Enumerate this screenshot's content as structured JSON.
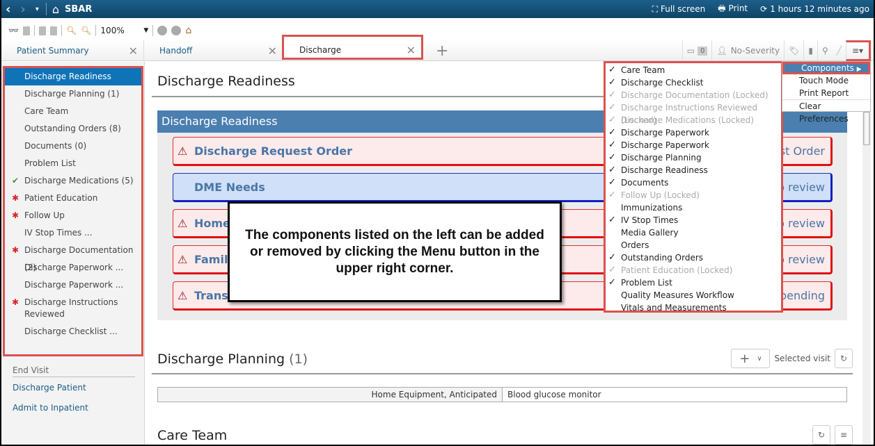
{
  "titlebar": {
    "back_icon": "‹",
    "forward_icon": "›",
    "dropdown_icon": "▾",
    "home_icon": "⌂",
    "title": "SBAR",
    "fullscreen_label": "Full screen",
    "print_label": "Print",
    "refresh_label": "1 hours 12 minutes ago"
  },
  "toolbar": {
    "zoom_value": "100%"
  },
  "tabs": {
    "patient_summary": "Patient Summary",
    "handoff": "Handoff",
    "discharge": "Discharge",
    "add": "+",
    "inbox_count": "0",
    "severity": "No-Severity"
  },
  "sidebar": {
    "items": [
      {
        "label": "Discharge Readiness",
        "mark": ""
      },
      {
        "label": "Discharge Planning  (1)",
        "mark": ""
      },
      {
        "label": "Care Team",
        "mark": ""
      },
      {
        "label": "Outstanding Orders  (8)",
        "mark": ""
      },
      {
        "label": "Documents  (0)",
        "mark": ""
      },
      {
        "label": "Problem List",
        "mark": ""
      },
      {
        "label": "Discharge Medications  (5)",
        "mark": "check"
      },
      {
        "label": "Patient Education",
        "mark": "star"
      },
      {
        "label": "Follow Up",
        "mark": "star"
      },
      {
        "label": "IV Stop Times ...",
        "mark": ""
      },
      {
        "label": "Discharge Documentation  (2)",
        "mark": "star"
      },
      {
        "label": "Discharge Paperwork ...",
        "mark": ""
      },
      {
        "label": "Discharge Paperwork ...",
        "mark": ""
      },
      {
        "label": "Discharge Instructions Reviewed",
        "mark": "star"
      },
      {
        "label": "Discharge Checklist ...",
        "mark": ""
      }
    ],
    "end_visit": "End Visit",
    "discharge_patient": "Discharge Patient",
    "admit_inpatient": "Admit to Inpatient"
  },
  "main": {
    "readiness_title": "Discharge Readiness",
    "readiness_header": "Discharge Readiness",
    "cards": [
      {
        "label": "Discharge Request Order",
        "right": "est Order",
        "style": "red",
        "warn": true
      },
      {
        "label": "DME Needs",
        "right": "to review",
        "style": "blue",
        "warn": false
      },
      {
        "label": "Home",
        "right": "to review",
        "style": "red",
        "warn": true
      },
      {
        "label": "Family",
        "right": "to review",
        "style": "red",
        "warn": true
      },
      {
        "label": "Transp",
        "right": "t pending",
        "style": "red",
        "warn": true
      }
    ],
    "planning_title": "Discharge Planning",
    "planning_count": "(1)",
    "selected_visit": "Selected visit",
    "planning_row": {
      "category": "Home Equipment, Anticipated",
      "value": "Blood glucose monitor"
    },
    "care_team_title": "Care Team"
  },
  "callout": {
    "text": "The components listed on the left can be added or removed by clicking the Menu button in the upper right corner."
  },
  "components_menu": [
    {
      "label": "Care Team",
      "checked": true,
      "locked": false
    },
    {
      "label": "Discharge Checklist",
      "checked": true,
      "locked": false
    },
    {
      "label": "Discharge Documentation (Locked)",
      "checked": true,
      "locked": true
    },
    {
      "label": "Discharge Instructions Reviewed (Locked)",
      "checked": true,
      "locked": true
    },
    {
      "label": "Discharge Medications (Locked)",
      "checked": true,
      "locked": true
    },
    {
      "label": "Discharge Paperwork",
      "checked": true,
      "locked": false
    },
    {
      "label": "Discharge Paperwork",
      "checked": true,
      "locked": false
    },
    {
      "label": "Discharge Planning",
      "checked": true,
      "locked": false
    },
    {
      "label": "Discharge Readiness",
      "checked": true,
      "locked": false
    },
    {
      "label": "Documents",
      "checked": true,
      "locked": false
    },
    {
      "label": "Follow Up (Locked)",
      "checked": true,
      "locked": true
    },
    {
      "label": "Immunizations",
      "checked": false,
      "locked": false
    },
    {
      "label": "IV Stop Times",
      "checked": true,
      "locked": false
    },
    {
      "label": "Media Gallery",
      "checked": false,
      "locked": false
    },
    {
      "label": "Orders",
      "checked": false,
      "locked": false
    },
    {
      "label": "Outstanding Orders",
      "checked": true,
      "locked": false
    },
    {
      "label": "Patient Education (Locked)",
      "checked": true,
      "locked": true
    },
    {
      "label": "Problem List",
      "checked": true,
      "locked": false
    },
    {
      "label": "Quality Measures Workflow",
      "checked": false,
      "locked": false
    },
    {
      "label": "Vitals and Measurements",
      "checked": false,
      "locked": false
    }
  ],
  "main_menu": {
    "components": "Components",
    "touch_mode": "Touch Mode",
    "print_report": "Print Report",
    "clear_preferences": "Clear Preferences"
  },
  "colors": {
    "accent": "#0f73b8",
    "header_blue": "#4a7fb0",
    "highlight_red": "#d9534f",
    "required_star": "#d9262b",
    "complete_check": "#3a9d23"
  }
}
